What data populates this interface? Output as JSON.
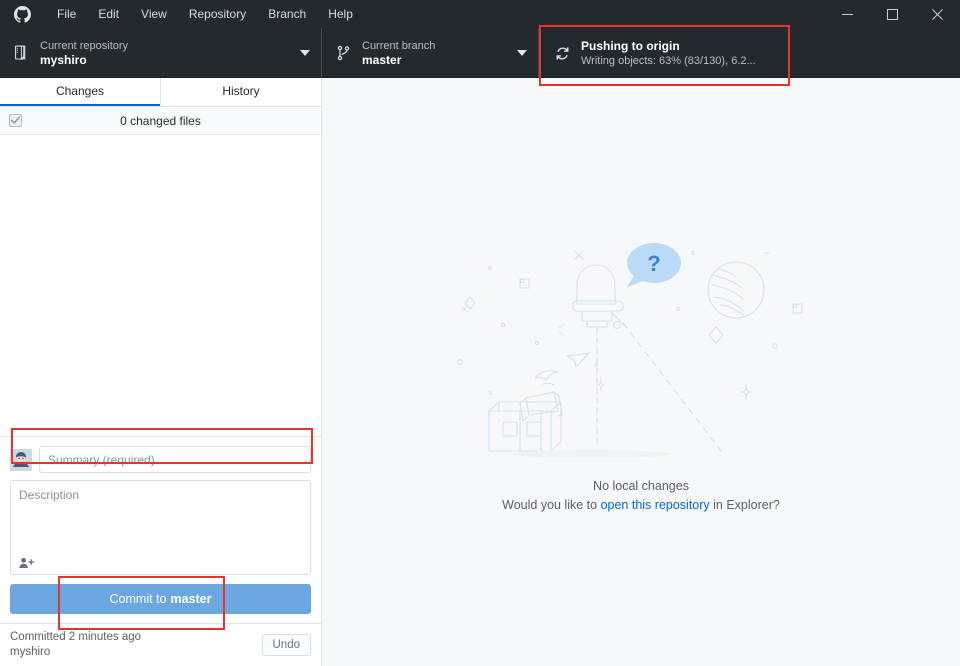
{
  "window": {
    "app_logo": "github-octocat-icon",
    "menu": [
      "File",
      "Edit",
      "View",
      "Repository",
      "Branch",
      "Help"
    ],
    "controls": {
      "minimize": "minimize-icon",
      "maximize": "maximize-icon",
      "close": "close-icon"
    }
  },
  "toolbar": {
    "repository": {
      "icon": "repository-book-icon",
      "label": "Current repository",
      "value": "myshiro",
      "caret": "chevron-down-icon"
    },
    "branch": {
      "icon": "branch-icon",
      "label": "Current branch",
      "value": "master",
      "caret": "chevron-down-icon"
    },
    "push": {
      "icon": "sync-spinner-icon",
      "title": "Pushing to origin",
      "detail": "Writing objects: 63% (83/130), 6.2...",
      "progress_percent": 63,
      "objects_written": 83,
      "objects_total": 130
    }
  },
  "sidebar": {
    "tabs": [
      {
        "label": "Changes",
        "active": true
      },
      {
        "label": "History",
        "active": false
      }
    ],
    "changed_files": {
      "checkbox": "checked-checkbox-icon",
      "label": "0 changed files",
      "count": 0
    },
    "commit_form": {
      "avatar": "user-avatar",
      "summary_placeholder": "Summary (required)",
      "summary_value": "",
      "description_placeholder": "Description",
      "description_value": "",
      "coauthor_icon": "add-coauthor-icon",
      "commit_button_prefix": "Commit to ",
      "commit_button_branch": "master"
    },
    "footer": {
      "committed_text": "Committed 2 minutes ago",
      "author": "myshiro",
      "undo_label": "Undo"
    }
  },
  "main": {
    "illustration": "telescope-empty-state-illustration",
    "title": "No local changes",
    "subtitle_before": "Would you like to ",
    "subtitle_link": "open this repository",
    "subtitle_after": " in Explorer?"
  },
  "colors": {
    "titlebar_bg": "#24292e",
    "toolbar_bg": "#24292e",
    "accent_blue": "#0366d6",
    "commit_button": "#6ca7e0",
    "main_bg": "#f6f8fa",
    "highlight_red": "#e3342f"
  }
}
